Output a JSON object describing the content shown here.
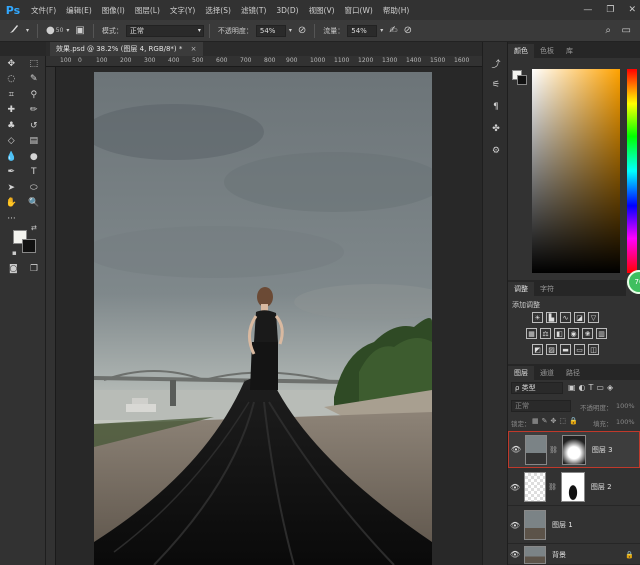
{
  "app": {
    "logo": "Ps"
  },
  "menu": [
    "文件(F)",
    "编辑(E)",
    "图像(I)",
    "图层(L)",
    "文字(Y)",
    "选择(S)",
    "滤镜(T)",
    "3D(D)",
    "视图(V)",
    "窗口(W)",
    "帮助(H)"
  ],
  "window_controls": {
    "minimize": "—",
    "restore": "❐",
    "close": "✕"
  },
  "options": {
    "brush_size": "50",
    "mode_label": "模式：",
    "mode_value": "正常",
    "opacity_label": "不透明度：",
    "opacity_value": "54%",
    "flow_label": "流量：",
    "flow_value": "54%"
  },
  "document": {
    "tab_label": "效果.psd @ 38.2% (图层 4, RGB/8*) *",
    "close": "×"
  },
  "ruler_top": [
    "100",
    "0",
    "100",
    "200",
    "300",
    "400",
    "500",
    "600",
    "700",
    "800",
    "900",
    "1000",
    "1100",
    "1200",
    "1300",
    "1400",
    "1500",
    "1600"
  ],
  "panels": {
    "color_tabs": [
      "颜色",
      "色板",
      "库"
    ],
    "adjust_tabs": [
      "调整",
      "字符"
    ],
    "adjust_title": "添加调整",
    "layers_tabs": [
      "图层",
      "通道",
      "路径"
    ],
    "layer_filter": "ρ 类型",
    "blend_mode": "正常",
    "opacity_label": "不透明度：",
    "opacity_value": "100%",
    "lock_label": "锁定：",
    "fill_label": "填充：",
    "fill_value": "100%",
    "badge": "76"
  },
  "layers": [
    {
      "name": "图层 3",
      "selected": true
    },
    {
      "name": "图层 2",
      "selected": false
    },
    {
      "name": "图层 1",
      "selected": false
    },
    {
      "name": "背景",
      "selected": false
    }
  ],
  "colors": {
    "accent": "#31a8ff",
    "foreground": "#f4f4f0",
    "background": "#111111",
    "selection": "#c0392b"
  }
}
